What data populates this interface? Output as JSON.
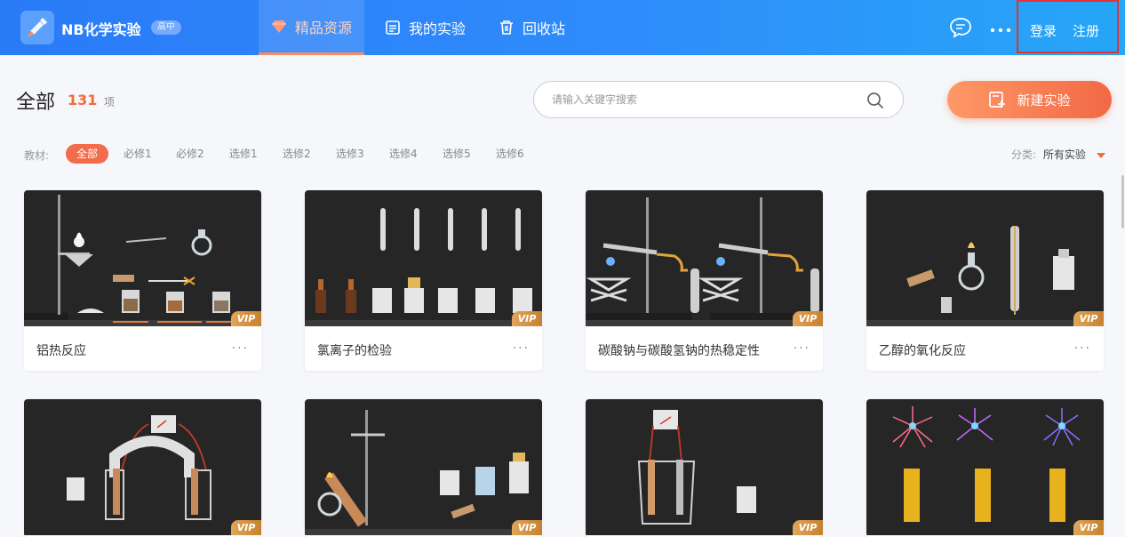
{
  "header": {
    "app_title": "NB化学实验",
    "level_badge": "高中",
    "nav": [
      {
        "label": "精品资源",
        "active": true
      },
      {
        "label": "我的实验",
        "active": false
      },
      {
        "label": "回收站",
        "active": false
      }
    ],
    "login": "登录",
    "register": "注册"
  },
  "toolbar": {
    "title": "全部",
    "count": "131",
    "count_unit": "项",
    "search_placeholder": "请输入关键字搜索",
    "new_button": "新建实验"
  },
  "filter": {
    "label": "教材:",
    "chips": [
      "全部",
      "必修1",
      "必修2",
      "选修1",
      "选修2",
      "选修3",
      "选修4",
      "选修5",
      "选修6"
    ],
    "active_chip": "全部",
    "category_label": "分类:",
    "category_value": "所有实验"
  },
  "cards": [
    {
      "title": "铝热反应",
      "badge": "VIP",
      "more": "···"
    },
    {
      "title": "氯离子的检验",
      "badge": "VIP",
      "more": "···"
    },
    {
      "title": "碳酸钠与碳酸氢钠的热稳定性",
      "badge": "VIP",
      "more": "···"
    },
    {
      "title": "乙醇的氧化反应",
      "badge": "VIP",
      "more": "···"
    },
    {
      "title": "",
      "badge": "VIP",
      "more": ""
    },
    {
      "title": "",
      "badge": "VIP",
      "more": ""
    },
    {
      "title": "",
      "badge": "VIP",
      "more": ""
    },
    {
      "title": "",
      "badge": "VIP",
      "more": ""
    }
  ],
  "colors": {
    "header_blue": "#2f8cfb",
    "accent_orange": "#f26b3a",
    "vip_gold": "#d39444"
  }
}
